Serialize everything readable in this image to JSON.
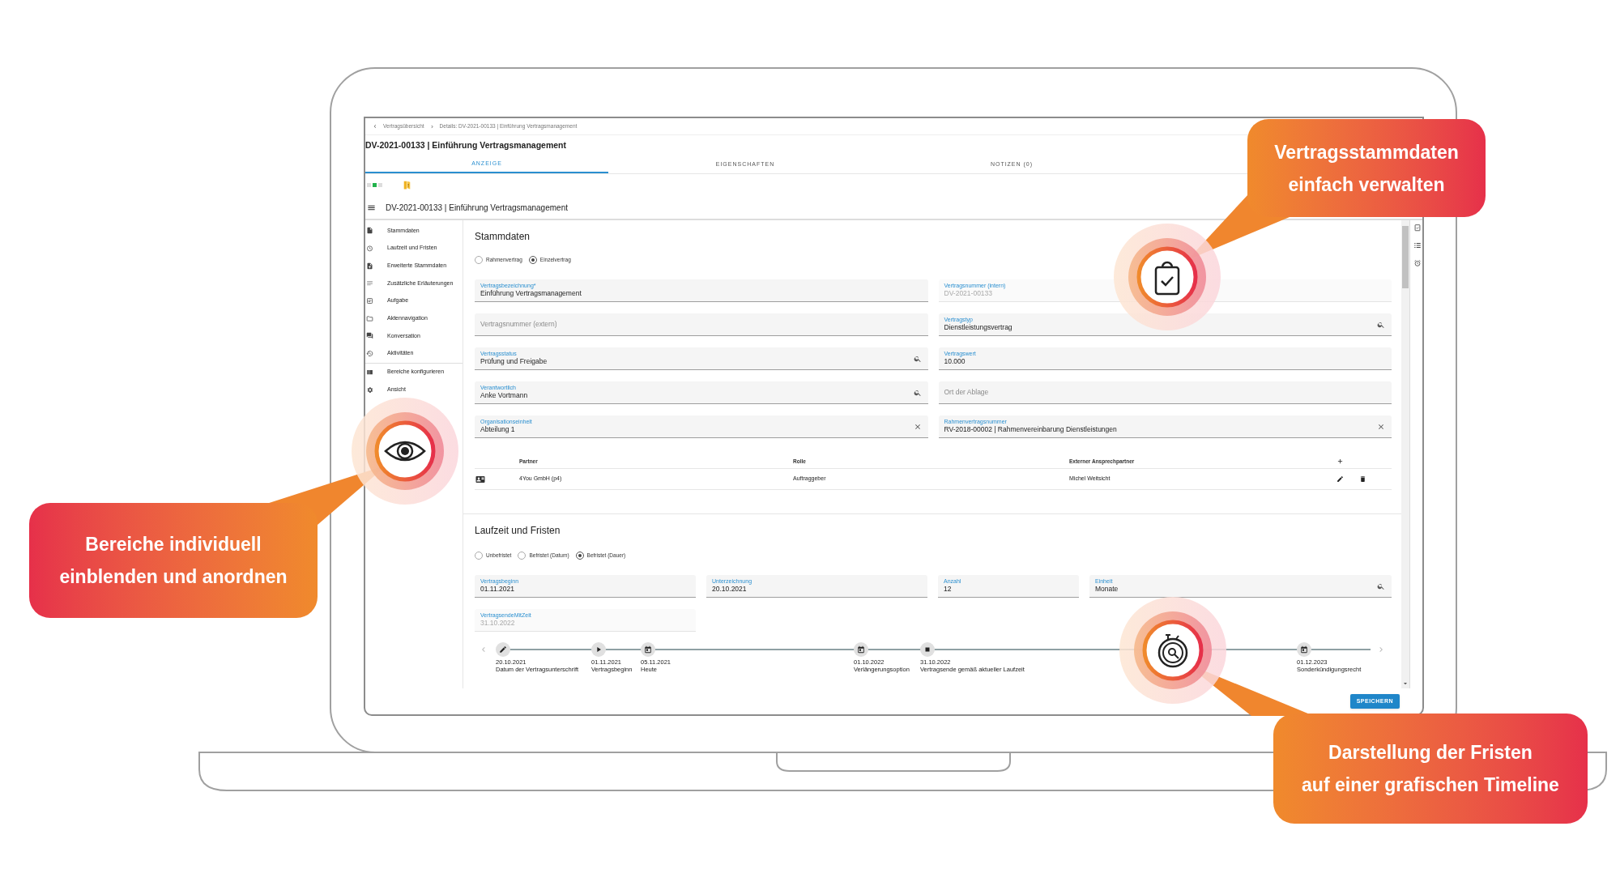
{
  "breadcrumb": [
    "Vertragsübersicht",
    "Details: DV-2021-00133 | Einführung Vertragsmanagement"
  ],
  "page_title": "DV-2021-00133 | Einführung Vertragsmanagement",
  "tabs": [
    {
      "label": "ANZEIGE",
      "selected": true
    },
    {
      "label": "EIGENSCHAFTEN",
      "selected": false
    },
    {
      "label": "NOTIZEN (0)",
      "selected": false
    }
  ],
  "toolbar_title": "DV-2021-00133 | Einführung Vertragsmanagement",
  "sidebar": {
    "sections": [
      {
        "items": [
          "Stammdaten",
          "Laufzeit und Fristen",
          "Erweiterte Stammdaten",
          "Zusätzliche Erläuterungen",
          "Aufgabe",
          "Aktennavigation",
          "Konversation",
          "Aktivitäten"
        ]
      },
      {
        "items": [
          "Bereiche konfigurieren",
          "Ansicht"
        ]
      }
    ]
  },
  "stammdaten": {
    "title": "Stammdaten",
    "contract_kind": [
      {
        "label": "Rahmenvertrag",
        "selected": false
      },
      {
        "label": "Einzelvertrag",
        "selected": true
      }
    ],
    "fields": [
      {
        "label": "Vertragsbezeichnung*",
        "value": "Einführung Vertragsmanagement",
        "kind": "text",
        "disabled": false
      },
      {
        "label": "Vertragsnummer (intern)",
        "value": "DV-2021-00133",
        "kind": "text",
        "disabled": true
      },
      {
        "placeholder": "Vertragsnummer (extern)",
        "kind": "text",
        "disabled": false
      },
      {
        "label": "Vertragstyp",
        "value": "Dienstleistungsvertrag",
        "kind": "search",
        "disabled": false
      },
      {
        "label": "Vertragsstatus",
        "value": "Prüfung und Freigabe",
        "kind": "search",
        "disabled": false
      },
      {
        "label": "Vertragswert",
        "value": "10.000",
        "kind": "text",
        "disabled": false
      },
      {
        "label": "Verantwortlich",
        "value": "Anke Vortmann",
        "kind": "search",
        "disabled": false
      },
      {
        "placeholder": "Ort der Ablage",
        "kind": "text",
        "disabled": false
      },
      {
        "label": "Organisationseinheit",
        "value": "Abteilung 1",
        "kind": "clear",
        "disabled": false
      },
      {
        "label": "Rahmenvertragsnummer",
        "value": "RV-2018-00002 | Rahmenvereinbarung Dienstleistungen",
        "kind": "clear",
        "disabled": false
      }
    ],
    "partners": {
      "columns": [
        "Partner",
        "Rolle",
        "Externer Ansprechpartner"
      ],
      "rows": [
        {
          "partner": "4You GmbH (p4)",
          "role": "Auftraggeber",
          "contact": "Michel Weitsicht"
        }
      ]
    }
  },
  "laufzeit": {
    "title": "Laufzeit und Fristen",
    "term_kind": [
      {
        "label": "Unbefristet",
        "selected": false
      },
      {
        "label": "Befristet (Datum)",
        "selected": false
      },
      {
        "label": "Befristet (Dauer)",
        "selected": true
      }
    ],
    "fields": [
      {
        "label": "Vertragsbeginn",
        "value": "01.11.2021",
        "kind": "text",
        "disabled": false
      },
      {
        "label": "Unterzeichnung",
        "value": "20.10.2021",
        "kind": "text",
        "disabled": false
      },
      {
        "label": "Anzahl",
        "value": "12",
        "kind": "text",
        "disabled": false
      },
      {
        "label": "Einheit",
        "value": "Monate",
        "kind": "search",
        "disabled": false
      },
      {
        "label": "VertragsendeMitZeit",
        "value": "31.10.2022",
        "kind": "text",
        "disabled": true
      }
    ],
    "timeline": [
      {
        "date": "20.10.2021",
        "label": "Datum der Vertragsunterschrift",
        "kind": "edit"
      },
      {
        "date": "01.11.2021",
        "label": "Vertragsbeginn",
        "kind": "play"
      },
      {
        "date": "05.11.2021",
        "label": "Heute",
        "kind": "calendar"
      },
      {
        "date": "01.10.2022",
        "label": "Verlängerungsoption",
        "kind": "calendar"
      },
      {
        "date": "31.10.2022",
        "label": "Vertragsende gemäß aktueller Laufzeit",
        "kind": "stop"
      },
      {
        "date": "01.12.2023",
        "label": "Sonderkündigungsrecht",
        "kind": "calendar"
      }
    ]
  },
  "save_button": "SPEICHERN",
  "callouts": [
    {
      "text": "Vertragsstammdaten\neinfach verwalten"
    },
    {
      "text": "Bereiche individuell\neinblenden und anordnen"
    },
    {
      "text": "Darstellung der Fristen\nauf einer grafischen Timeline"
    }
  ]
}
